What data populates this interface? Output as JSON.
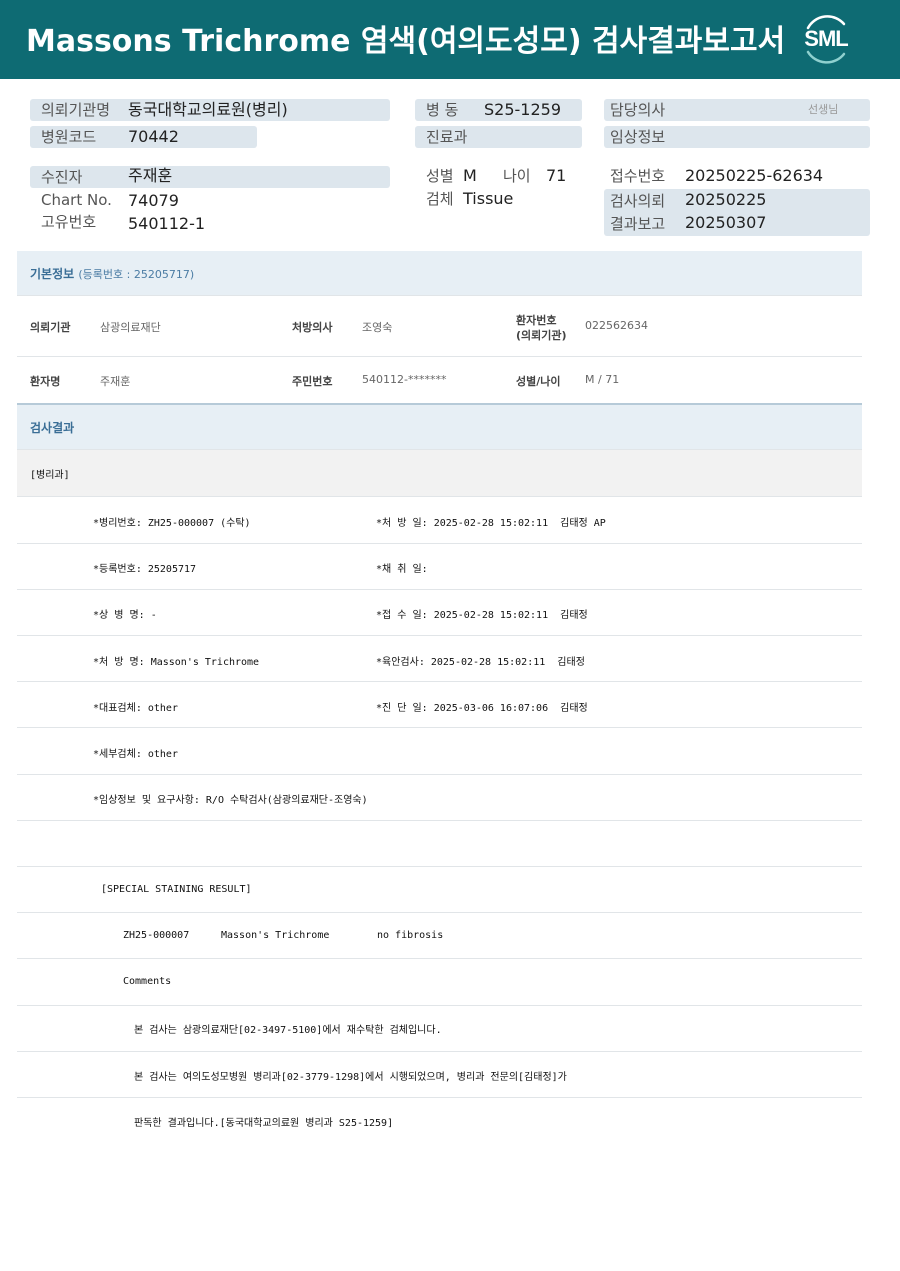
{
  "report": {
    "title": "Massons  Trichrome 염색(여의도성모) 검사결과보고서",
    "logo": "SML"
  },
  "header": {
    "institution_label": "의뢰기관명",
    "institution_value": "동국대학교의료원(병리)",
    "hospital_code_label": "병원코드",
    "hospital_code_value": "70442",
    "ward_label": "병  동",
    "ward_value": "S25-1259",
    "department_label": "진료과",
    "department_value": "",
    "doctor_label": "담당의사",
    "doctor_suffix": "선생님",
    "clinical_label": "임상정보",
    "clinical_value": "",
    "patient_label": "수진자",
    "patient_value": "주재훈",
    "chart_label": "Chart No.",
    "chart_value": "74079",
    "unique_label": "고유번호",
    "unique_value": "540112-1",
    "sex_label": "성별",
    "sex_value": "M",
    "age_label": "나이",
    "age_value": "71",
    "specimen_label": "검체",
    "specimen_value": "Tissue",
    "receipt_label": "접수번호",
    "receipt_value": "20250225-62634",
    "request_label": "검사의뢰",
    "request_value": "20250225",
    "result_label": "결과보고",
    "result_value": "20250307"
  },
  "basic_info": {
    "title": "기본정보",
    "reg_note": "(등록번호 : 25205717)",
    "institution_label": "의뢰기관",
    "institution_value": "삼광의료재단",
    "prescriber_label": "처방의사",
    "prescriber_value": "조영숙",
    "patient_no_label_1": "환자번호",
    "patient_no_label_2": "(의뢰기관)",
    "patient_no_value": "022562634",
    "name_label": "환자명",
    "name_value": "주재훈",
    "id_label": "주민번호",
    "id_value": "540112-*******",
    "sex_age_label": "성별/나이",
    "sex_age_value": "M / 71"
  },
  "results": {
    "title": "검사결과",
    "dept": "[병리과]",
    "pathology_no": "*병리번호: ZH25-000007 (수탁)",
    "prescribed_date": "*처 방 일: 2025-02-28 15:02:11  김태정 AP",
    "reg_no": "*등록번호: 25205717",
    "collected_date": "*채 취 일:",
    "disease_name": "*상 병 명: -",
    "received_date": "*접 수 일: 2025-02-28 15:02:11  김태정",
    "prescription_name": "*처 방 명: Masson's Trichrome",
    "gross_exam": "*육안검사: 2025-02-28 15:02:11  김태정",
    "main_specimen": "*대표검체: other",
    "diagnosis_date": "*진 단 일: 2025-03-06 16:07:06  김태정",
    "sub_specimen": "*세부검체: other",
    "clinical_info": "*임상정보 및 요구사항: R/O 수탁검사(삼광의료재단-조영숙)",
    "staining_header": "[SPECIAL STAINING RESULT]",
    "stain_case": "ZH25-000007",
    "stain_name": "Masson's Trichrome",
    "stain_result": "no fibrosis",
    "comments": "Comments",
    "comment_line_1": "본 검사는 삼광의료재단[02-3497-5100]에서 재수탁한 검체입니다.",
    "comment_line_2": "본 검사는 여의도성모병원 병리과[02-3779-1298]에서 시행되었으며, 병리과 전문의[김태정]가",
    "comment_line_3": "판독한 결과입니다.[동국대학교의료원 병리과 S25-1259]"
  },
  "colors": {
    "banner": "#0e6b73",
    "header_bar": "#dde6ed",
    "section_bg": "#e7eff5",
    "section_title": "#3a6e96"
  }
}
